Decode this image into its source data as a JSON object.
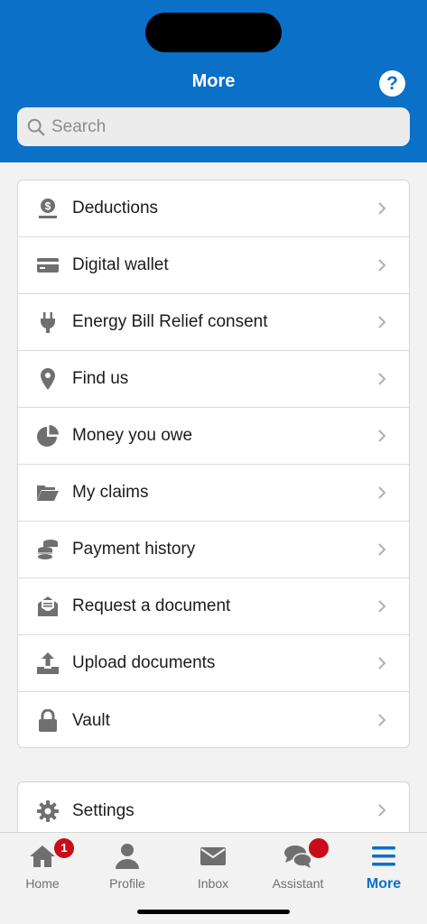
{
  "header": {
    "title": "More",
    "help_label": "?"
  },
  "search": {
    "placeholder": "Search"
  },
  "menu": {
    "items": [
      {
        "label": "Deductions",
        "icon": "money-bag-icon"
      },
      {
        "label": "Digital wallet",
        "icon": "credit-card-icon"
      },
      {
        "label": "Energy Bill Relief consent",
        "icon": "plug-icon"
      },
      {
        "label": "Find us",
        "icon": "map-pin-icon"
      },
      {
        "label": "Money you owe",
        "icon": "pie-chart-icon"
      },
      {
        "label": "My claims",
        "icon": "folder-open-icon"
      },
      {
        "label": "Payment history",
        "icon": "coins-icon"
      },
      {
        "label": "Request a document",
        "icon": "envelope-document-icon"
      },
      {
        "label": "Upload documents",
        "icon": "upload-icon"
      },
      {
        "label": "Vault",
        "icon": "lock-icon"
      }
    ],
    "settings": {
      "label": "Settings",
      "icon": "gear-icon"
    }
  },
  "tabbar": {
    "tabs": [
      {
        "label": "Home",
        "icon": "home-icon",
        "badge": "1"
      },
      {
        "label": "Profile",
        "icon": "person-icon"
      },
      {
        "label": "Inbox",
        "icon": "envelope-icon"
      },
      {
        "label": "Assistant",
        "icon": "chat-bubbles-icon"
      },
      {
        "label": "More",
        "icon": "hamburger-menu-icon"
      }
    ]
  },
  "colors": {
    "brand": "#0a70c8",
    "badge": "#c80c1a",
    "icon_gray": "#6f6f6f"
  }
}
